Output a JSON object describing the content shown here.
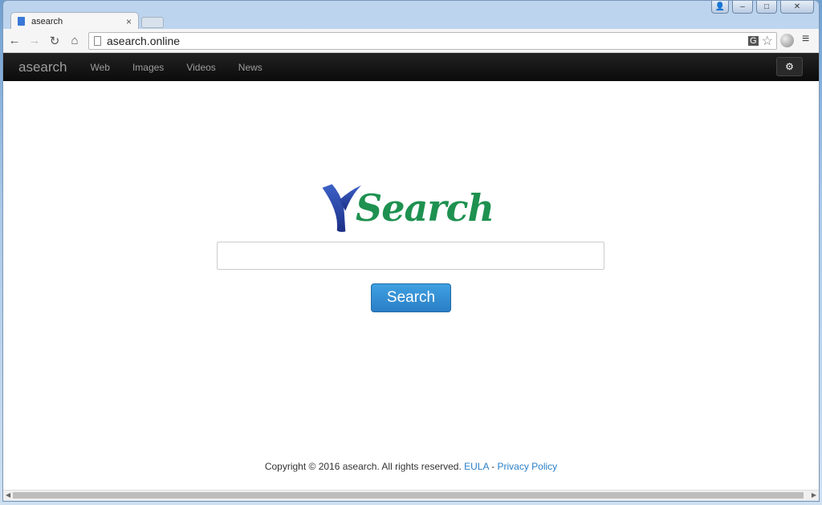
{
  "browser": {
    "tab_title": "asearch",
    "tab_close": "×",
    "url": "asearch.online",
    "window_buttons": [
      "👤",
      "–",
      "□",
      "✕"
    ],
    "icons": [
      "back-icon",
      "forward-icon",
      "reload-icon",
      "home-icon",
      "translate-icon",
      "star-icon",
      "globe-icon",
      "menu-icon"
    ]
  },
  "navbar": {
    "brand": "asearch",
    "links": [
      "Web",
      "Images",
      "Videos",
      "News"
    ],
    "settings_icon": "gear-icon"
  },
  "logo": {
    "text": "Search",
    "y_color": "#2a45a8",
    "text_color": "#1e9150"
  },
  "search": {
    "value": "",
    "button_label": "Search"
  },
  "footer": {
    "copyright": "Copyright © 2016 asearch. All rights reserved. ",
    "eula": "EULA",
    "separator": " - ",
    "privacy": "Privacy Policy"
  },
  "colors": {
    "navbar": "#111111",
    "button": "#2a7fc6",
    "link": "#2a7fc6"
  }
}
